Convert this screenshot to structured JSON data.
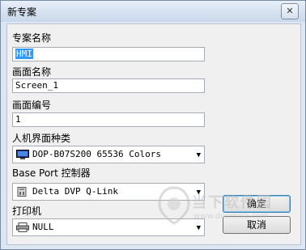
{
  "window": {
    "title": "新专案",
    "close": "✕"
  },
  "fields": {
    "project_name_label": "专案名称",
    "project_name_value": "HMI",
    "screen_name_label": "画面名称",
    "screen_name_value": "Screen_1",
    "screen_number_label": "画面编号",
    "screen_number_value": "1",
    "hmi_type_label": "人机界面种类",
    "hmi_type_value": "DOP-B07S200 65536 Colors",
    "base_port_label": "Base Port 控制器",
    "base_port_value": "Delta DVP Q-Link",
    "printer_label": "打印机",
    "printer_value": "NULL"
  },
  "buttons": {
    "ok": "确定",
    "cancel": "取消"
  },
  "watermark": {
    "main": "当下软件园",
    "sub": "www.downxia.com"
  },
  "icons": [
    "monitor-icon",
    "plc-icon",
    "printer-icon",
    "dropdown-arrow-icon",
    "close-icon"
  ]
}
